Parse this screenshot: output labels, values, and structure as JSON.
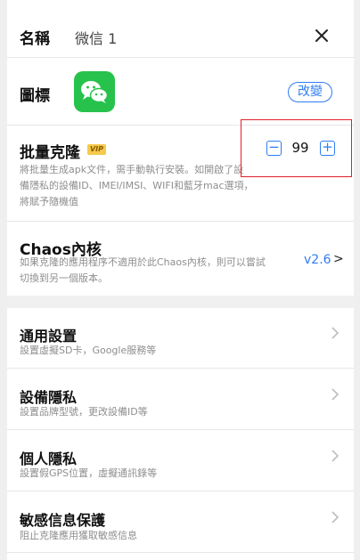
{
  "header": {
    "name_label": "名稱",
    "name_value": "微信 1",
    "close_icon": "close-icon"
  },
  "icon_row": {
    "label": "圖標",
    "app_icon": "wechat-icon",
    "change_label": "改變",
    "brand_color": "#27c24c"
  },
  "batch": {
    "title": "批量克隆",
    "badge": "VIP",
    "desc_lines": [
      "將批量生成apk文件，需手動執行安裝。如開啟了設",
      "備隱私的設備ID、IMEI/IMSI、WIFI和藍牙mac選項，",
      "將賦予隨機值"
    ],
    "count": "99",
    "minus": "−",
    "plus": "+"
  },
  "chaos": {
    "title": "Chaos內核",
    "desc_lines": [
      "如果克隆的應用程序不適用於此Chaos內核，則可以嘗試",
      "切換到另一個版本。"
    ],
    "version": "v2.6",
    "arrow": ">"
  },
  "menu": [
    {
      "title": "通用設置",
      "subtitle": "設置虛擬SD卡，Google服務等"
    },
    {
      "title": "設備隱私",
      "subtitle": "設置品牌型號，更改設備ID等"
    },
    {
      "title": "個人隱私",
      "subtitle": "設置假GPS位置，虛擬通訊錄等"
    },
    {
      "title": "敏感信息保護",
      "subtitle": "阻止克隆應用獲取敏感信息"
    }
  ],
  "colors": {
    "accent": "#2f7df2",
    "highlight_box": "#e0202b",
    "vip_badge": "#f5c94b"
  }
}
